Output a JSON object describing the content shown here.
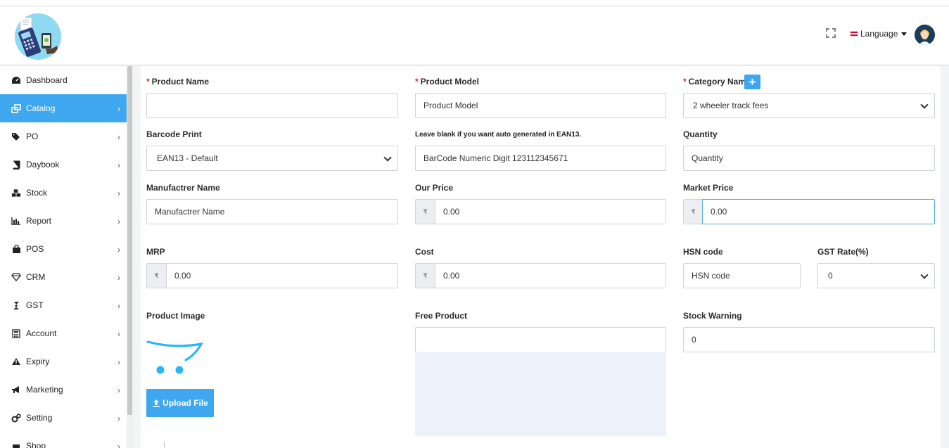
{
  "header": {
    "language_label": "Language"
  },
  "sidebar": {
    "items": [
      {
        "label": "Dashboard",
        "icon": "dashboard-icon",
        "chevron": false,
        "active": false
      },
      {
        "label": "Catalog",
        "icon": "catalog-icon",
        "chevron": true,
        "active": true
      },
      {
        "label": "PO",
        "icon": "tags-icon",
        "chevron": true,
        "active": false
      },
      {
        "label": "Daybook",
        "icon": "book-icon",
        "chevron": true,
        "active": false
      },
      {
        "label": "Stock",
        "icon": "cubes-icon",
        "chevron": true,
        "active": false
      },
      {
        "label": "Report",
        "icon": "bar-chart-icon",
        "chevron": true,
        "active": false
      },
      {
        "label": "POS",
        "icon": "shopping-bag-icon",
        "chevron": true,
        "active": false
      },
      {
        "label": "CRM",
        "icon": "diamond-icon",
        "chevron": true,
        "active": false
      },
      {
        "label": "GST",
        "icon": "gst-icon",
        "chevron": true,
        "active": false
      },
      {
        "label": "Account",
        "icon": "calculator-icon",
        "chevron": true,
        "active": false
      },
      {
        "label": "Expiry",
        "icon": "warning-icon",
        "chevron": true,
        "active": false
      },
      {
        "label": "Marketing",
        "icon": "bullhorn-icon",
        "chevron": true,
        "active": false
      },
      {
        "label": "Setting",
        "icon": "gears-icon",
        "chevron": true,
        "active": false
      },
      {
        "label": "Shop",
        "icon": "shop-icon",
        "chevron": true,
        "active": false
      }
    ]
  },
  "form": {
    "product_name": {
      "label": "Product Name",
      "value": ""
    },
    "product_model": {
      "label": "Product Model",
      "value": "Product Model"
    },
    "category_name": {
      "label": "Category Name",
      "selected": "2 wheeler track fees"
    },
    "barcode_print": {
      "label": "Barcode Print",
      "selected": "EAN13 - Default"
    },
    "barcode_hint": "Leave blank if you want auto generated in EAN13.",
    "barcode_value": "BarCode Numeric Digit 123112345671",
    "quantity": {
      "label": "Quantity",
      "value": "Quantity"
    },
    "manufacturer": {
      "label": "Manufactrer Name",
      "value": "Manufactrer Name"
    },
    "our_price": {
      "label": "Our Price",
      "currency": "₹",
      "value": "0.00"
    },
    "market_price": {
      "label": "Market Price",
      "currency": "₹",
      "value": "0.00"
    },
    "mrp": {
      "label": "MRP",
      "currency": "₹",
      "value": "0.00"
    },
    "cost": {
      "label": "Cost",
      "currency": "₹",
      "value": "0.00"
    },
    "hsn_code": {
      "label": "HSN code",
      "value": "HSN code"
    },
    "gst_rate": {
      "label": "GST Rate(%)",
      "selected": "0"
    },
    "product_image": {
      "label": "Product Image",
      "upload_label": "Upload File"
    },
    "free_product": {
      "label": "Free Product",
      "value": ""
    },
    "stock_warning": {
      "label": "Stock Warning",
      "value": "0"
    }
  },
  "colors": {
    "accent": "#3ea7ef",
    "required": "#e02020"
  }
}
